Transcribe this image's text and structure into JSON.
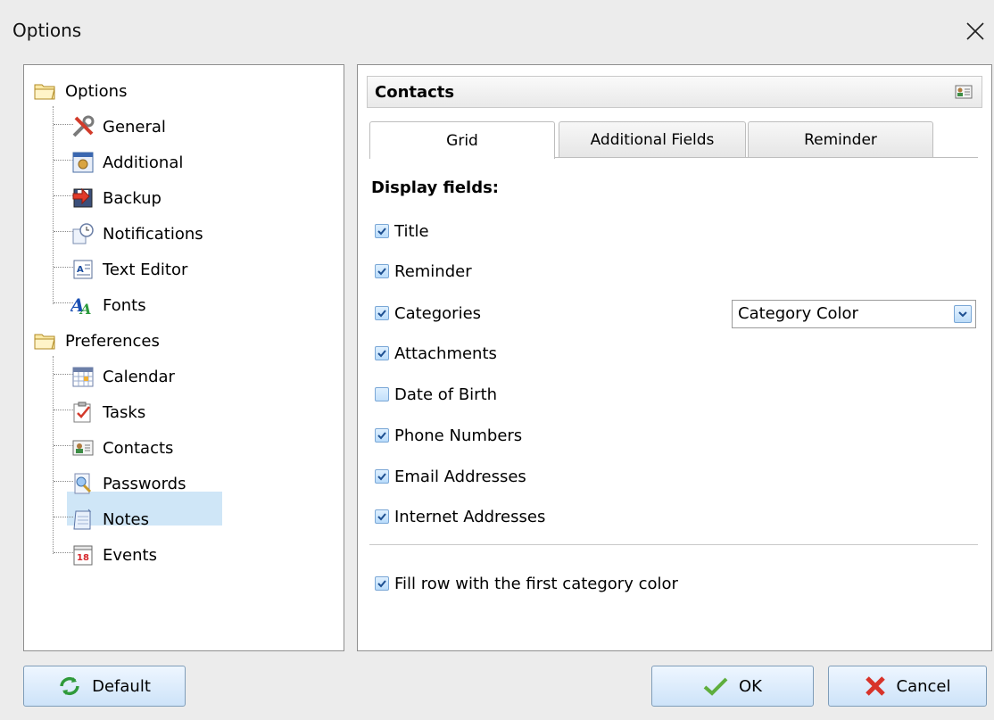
{
  "window": {
    "title": "Options",
    "close_glyph": "✕"
  },
  "tree": {
    "options_root": "Options",
    "options_children": [
      "General",
      "Additional",
      "Backup",
      "Notifications",
      "Text Editor",
      "Fonts"
    ],
    "preferences_root": "Preferences",
    "preferences_children": [
      "Calendar",
      "Tasks",
      "Contacts",
      "Passwords",
      "Notes",
      "Events"
    ],
    "selected": "Contacts",
    "events_icon_text": "18"
  },
  "panel": {
    "header": "Contacts",
    "tabs": [
      "Grid",
      "Additional Fields",
      "Reminder"
    ],
    "active_tab": "Grid",
    "display_fields_label": "Display fields:",
    "fields": [
      {
        "label": "Title",
        "checked": true
      },
      {
        "label": "Reminder",
        "checked": true
      },
      {
        "label": "Categories",
        "checked": true
      },
      {
        "label": "Attachments",
        "checked": true
      },
      {
        "label": "Date of Birth",
        "checked": false
      },
      {
        "label": "Phone Numbers",
        "checked": true
      },
      {
        "label": "Email Addresses",
        "checked": true
      },
      {
        "label": "Internet Addresses",
        "checked": true
      }
    ],
    "category_select": "Category Color",
    "fill_row": {
      "label": "Fill row with the first category color",
      "checked": true
    }
  },
  "buttons": {
    "default": "Default",
    "ok": "OK",
    "cancel": "Cancel"
  },
  "colors": {
    "selection": "#cfe6f7",
    "checkbox_border": "#7aa7d6",
    "button_grad_top": "#eef6ff",
    "button_grad_bottom": "#cde3f9"
  }
}
